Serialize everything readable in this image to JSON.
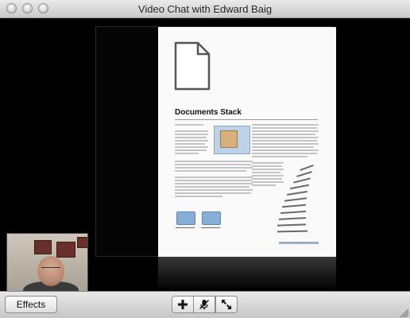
{
  "window": {
    "title": "Video Chat with Edward Baig"
  },
  "document": {
    "heading": "Documents Stack"
  },
  "toolbar": {
    "effects_label": "Effects",
    "icons": [
      "add-icon",
      "mute-microphone-icon",
      "fullscreen-icon"
    ]
  },
  "colors": {
    "titlebar_top": "#eaeaea",
    "titlebar_bottom": "#c9c9c9",
    "toolbar_top": "#e8e8e8",
    "toolbar_bottom": "#c6c6c6",
    "video_bg": "#000000"
  }
}
